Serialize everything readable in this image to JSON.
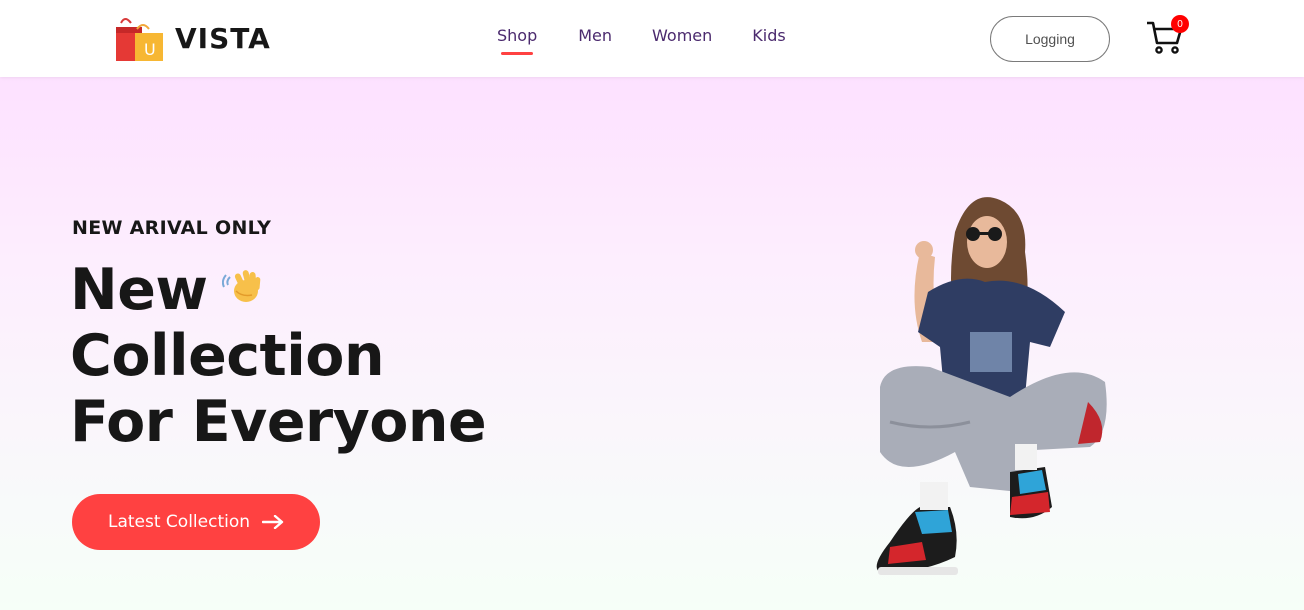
{
  "brand": {
    "name": "VISTA",
    "logo_icon": "shopping-bags-icon"
  },
  "nav": {
    "items": [
      {
        "label": "Shop",
        "active": true
      },
      {
        "label": "Men",
        "active": false
      },
      {
        "label": "Women",
        "active": false
      },
      {
        "label": "Kids",
        "active": false
      }
    ],
    "active_underline_color": "#ff4141"
  },
  "header": {
    "login_label": "Logging",
    "cart_icon": "cart-icon",
    "cart_count": "0"
  },
  "hero": {
    "tag": "NEW ARIVAL ONLY",
    "title_lines": [
      "New",
      "Collection",
      "For Everyone"
    ],
    "title_emoji": "waving-hand-icon",
    "cta_label": "Latest Collection",
    "cta_icon": "arrow-right-icon",
    "cta_color": "#ff4141",
    "image_icon": "model-photo"
  }
}
